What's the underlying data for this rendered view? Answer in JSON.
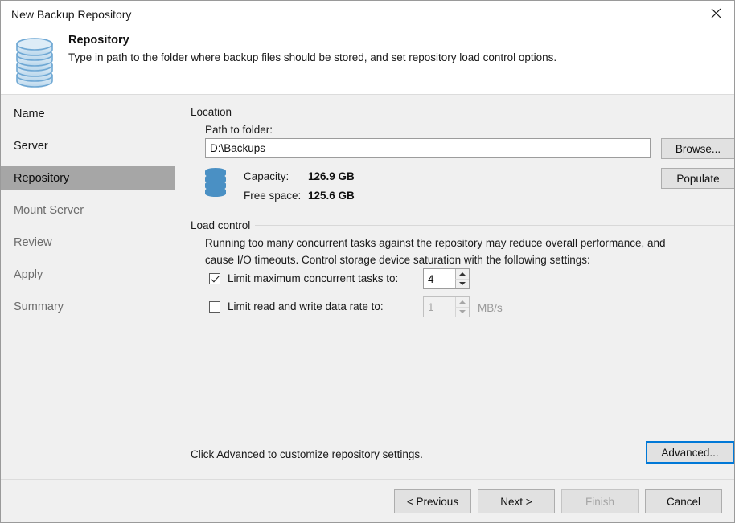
{
  "window": {
    "title": "New Backup Repository",
    "close_icon": "close-icon"
  },
  "header": {
    "icon": "database-icon",
    "title": "Repository",
    "subtitle": "Type in path to the folder where backup files should be stored, and set repository load control options."
  },
  "sidebar": {
    "items": [
      {
        "label": "Name",
        "state": "done"
      },
      {
        "label": "Server",
        "state": "done"
      },
      {
        "label": "Repository",
        "state": "active"
      },
      {
        "label": "Mount Server",
        "state": "upcoming"
      },
      {
        "label": "Review",
        "state": "upcoming"
      },
      {
        "label": "Apply",
        "state": "upcoming"
      },
      {
        "label": "Summary",
        "state": "upcoming"
      }
    ]
  },
  "location": {
    "group_label": "Location",
    "path_label": "Path to folder:",
    "path_value": "D:\\Backups",
    "path_placeholder": "",
    "browse_label": "Browse...",
    "populate_label": "Populate",
    "storage_icon": "database-icon",
    "capacity_label": "Capacity:",
    "capacity_value": "126.9 GB",
    "free_space_label": "Free space:",
    "free_space_value": "125.6 GB"
  },
  "load_control": {
    "group_label": "Load control",
    "description_line1": "Running too many concurrent tasks against the repository may reduce overall performance, and",
    "description_line2": "cause I/O timeouts. Control storage device saturation with the following settings:",
    "limit_tasks": {
      "label": "Limit maximum concurrent tasks to:",
      "checked": true,
      "value": "4"
    },
    "limit_rate": {
      "label": "Limit read and write data rate to:",
      "checked": false,
      "value": "1",
      "unit": "MB/s"
    }
  },
  "advanced": {
    "hint": "Click Advanced to customize repository settings.",
    "button_label": "Advanced..."
  },
  "footer": {
    "previous_label": "< Previous",
    "next_label": "Next >",
    "finish_label": "Finish",
    "cancel_label": "Cancel"
  },
  "colors": {
    "accent": "#0078d7",
    "selection": "#a6a6a6",
    "icon_blue": "#4a90c4",
    "window_bg": "#f0f0f0"
  }
}
